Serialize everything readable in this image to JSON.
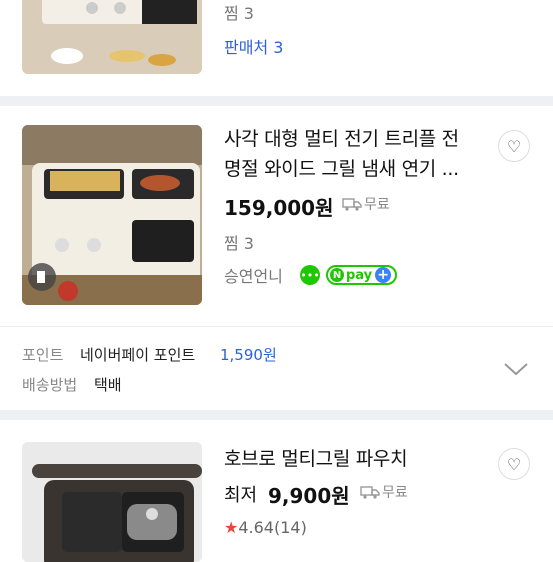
{
  "top_product": {
    "wishlist": "찜 3",
    "sellers": "판매처 3"
  },
  "product1": {
    "title_line1": "사각 대형 멀티 전기 트리플 전",
    "title_line2": "명절 와이드 그릴 냄새 연기 ...",
    "price": "159,000원",
    "shipping": "무료",
    "wishlist": "찜 3",
    "seller": "승연언니",
    "npay_label": "pay"
  },
  "benefits": {
    "point_label": "포인트",
    "point_desc": "네이버페이 포인트",
    "point_value": "1,590원",
    "delivery_label": "배송방법",
    "delivery_value": "택배"
  },
  "product2": {
    "title": "호브로 멀티그릴 파우치",
    "price_prefix": "최저",
    "price": "9,900원",
    "shipping": "무료",
    "rating": "4.64",
    "reviews": "(14)"
  },
  "colors": {
    "accent_blue": "#2c62d8",
    "naver_green": "#1ec800",
    "star_red": "#e8453c"
  }
}
